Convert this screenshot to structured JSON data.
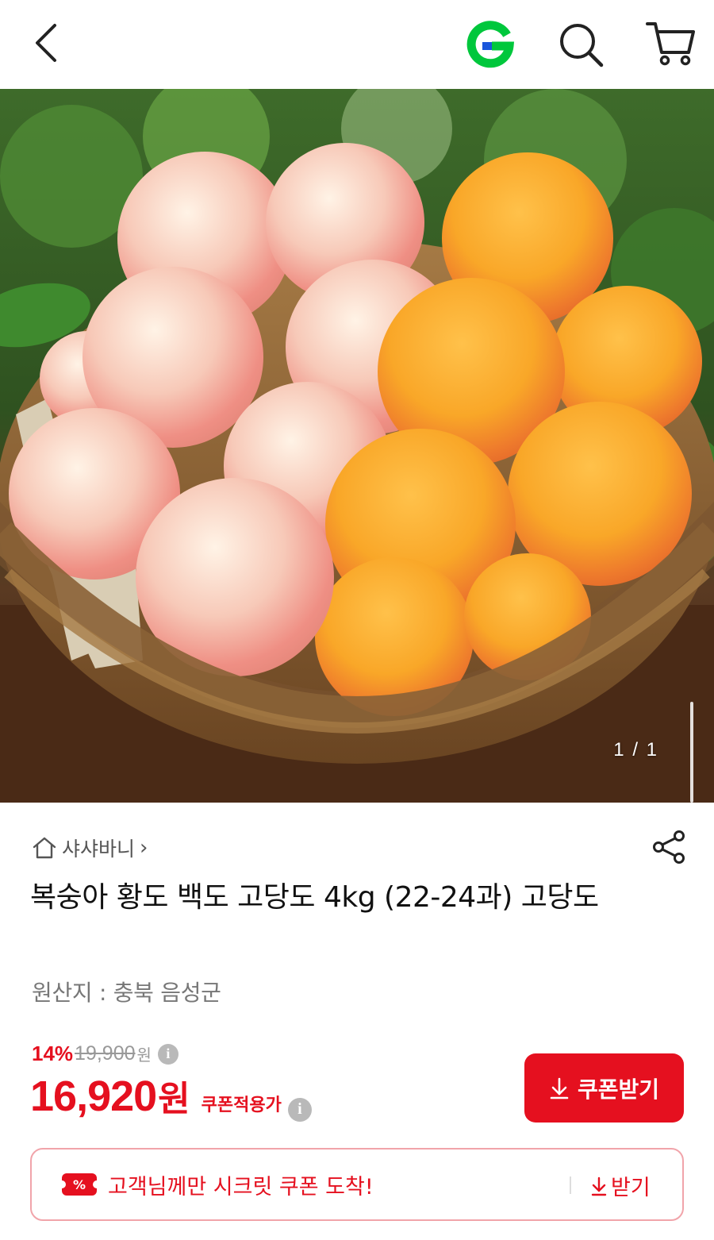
{
  "header": {
    "back_icon": "chevron-left-icon",
    "logo_icon": "gmarket-g-logo",
    "search_icon": "search-icon",
    "cart_icon": "cart-icon",
    "logo_color": "#00c73c"
  },
  "hero": {
    "image_description_icon": "peach-basket-photo",
    "counter": "1 / 1"
  },
  "seller": {
    "icon": "home-icon",
    "name": "샤샤바니",
    "chevron": "›"
  },
  "share_icon": "share-icon",
  "product": {
    "title": "복숭아 황도 백도 고당도 4kg (22-24과) 고당도",
    "origin": "원산지 : 충북 음성군"
  },
  "price": {
    "discount_pct": "14%",
    "original_price": "19,900",
    "original_unit": "원",
    "sale_price": "16,920",
    "sale_unit": "원",
    "label": "쿠폰적용가",
    "info_glyph": "i",
    "accent_color": "#e5101f"
  },
  "coupon_button": {
    "label": "쿠폰받기",
    "icon": "download-arrow-icon"
  },
  "secret_coupon": {
    "tag": "%",
    "message": "고객님께만 시크릿 쿠폰 도착!",
    "action": "받기"
  }
}
